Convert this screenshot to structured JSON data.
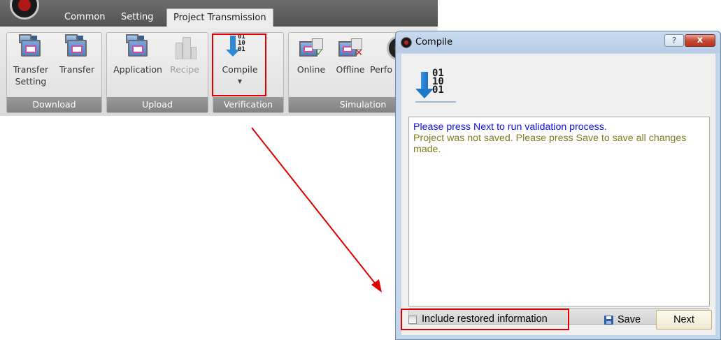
{
  "ribbon": {
    "tabs": [
      {
        "label": "Common"
      },
      {
        "label": "Setting"
      },
      {
        "label": "Project Transmission",
        "active": true
      }
    ],
    "groups": {
      "download": {
        "label": "Download",
        "buttons": [
          {
            "label": "Transfer\nSetting",
            "icon": "transfer-setting-icon"
          },
          {
            "label": "Transfer",
            "icon": "transfer-icon"
          }
        ]
      },
      "upload": {
        "label": "Upload",
        "buttons": [
          {
            "label": "Application",
            "icon": "application-icon"
          },
          {
            "label": "Recipe",
            "icon": "recipe-icon",
            "disabled": true
          }
        ]
      },
      "verification": {
        "label": "Verification",
        "buttons": [
          {
            "label": "Compile",
            "icon": "compile-icon",
            "dropdown": true
          }
        ]
      },
      "simulation": {
        "label": "Simulation",
        "buttons": [
          {
            "label": "Online",
            "icon": "online-simulation-icon"
          },
          {
            "label": "Offline",
            "icon": "offline-simulation-icon"
          },
          {
            "label": "Perfo",
            "icon": "performance-icon"
          }
        ]
      }
    }
  },
  "dialog": {
    "title": "Compile",
    "help_label": "?",
    "close_label": "x",
    "icon_bits": "01\n10\n01",
    "messages": {
      "line1": "Please press Next to run validation process.",
      "line2": "Project was not saved. Please press Save to save all changes made."
    },
    "include_restored_label": "Include restored information",
    "include_restored_checked": false,
    "save_label": "Save",
    "next_label": "Next"
  },
  "colors": {
    "highlight": "#e00000",
    "message_info": "#1010ee",
    "message_warning": "#7d7d1e"
  }
}
